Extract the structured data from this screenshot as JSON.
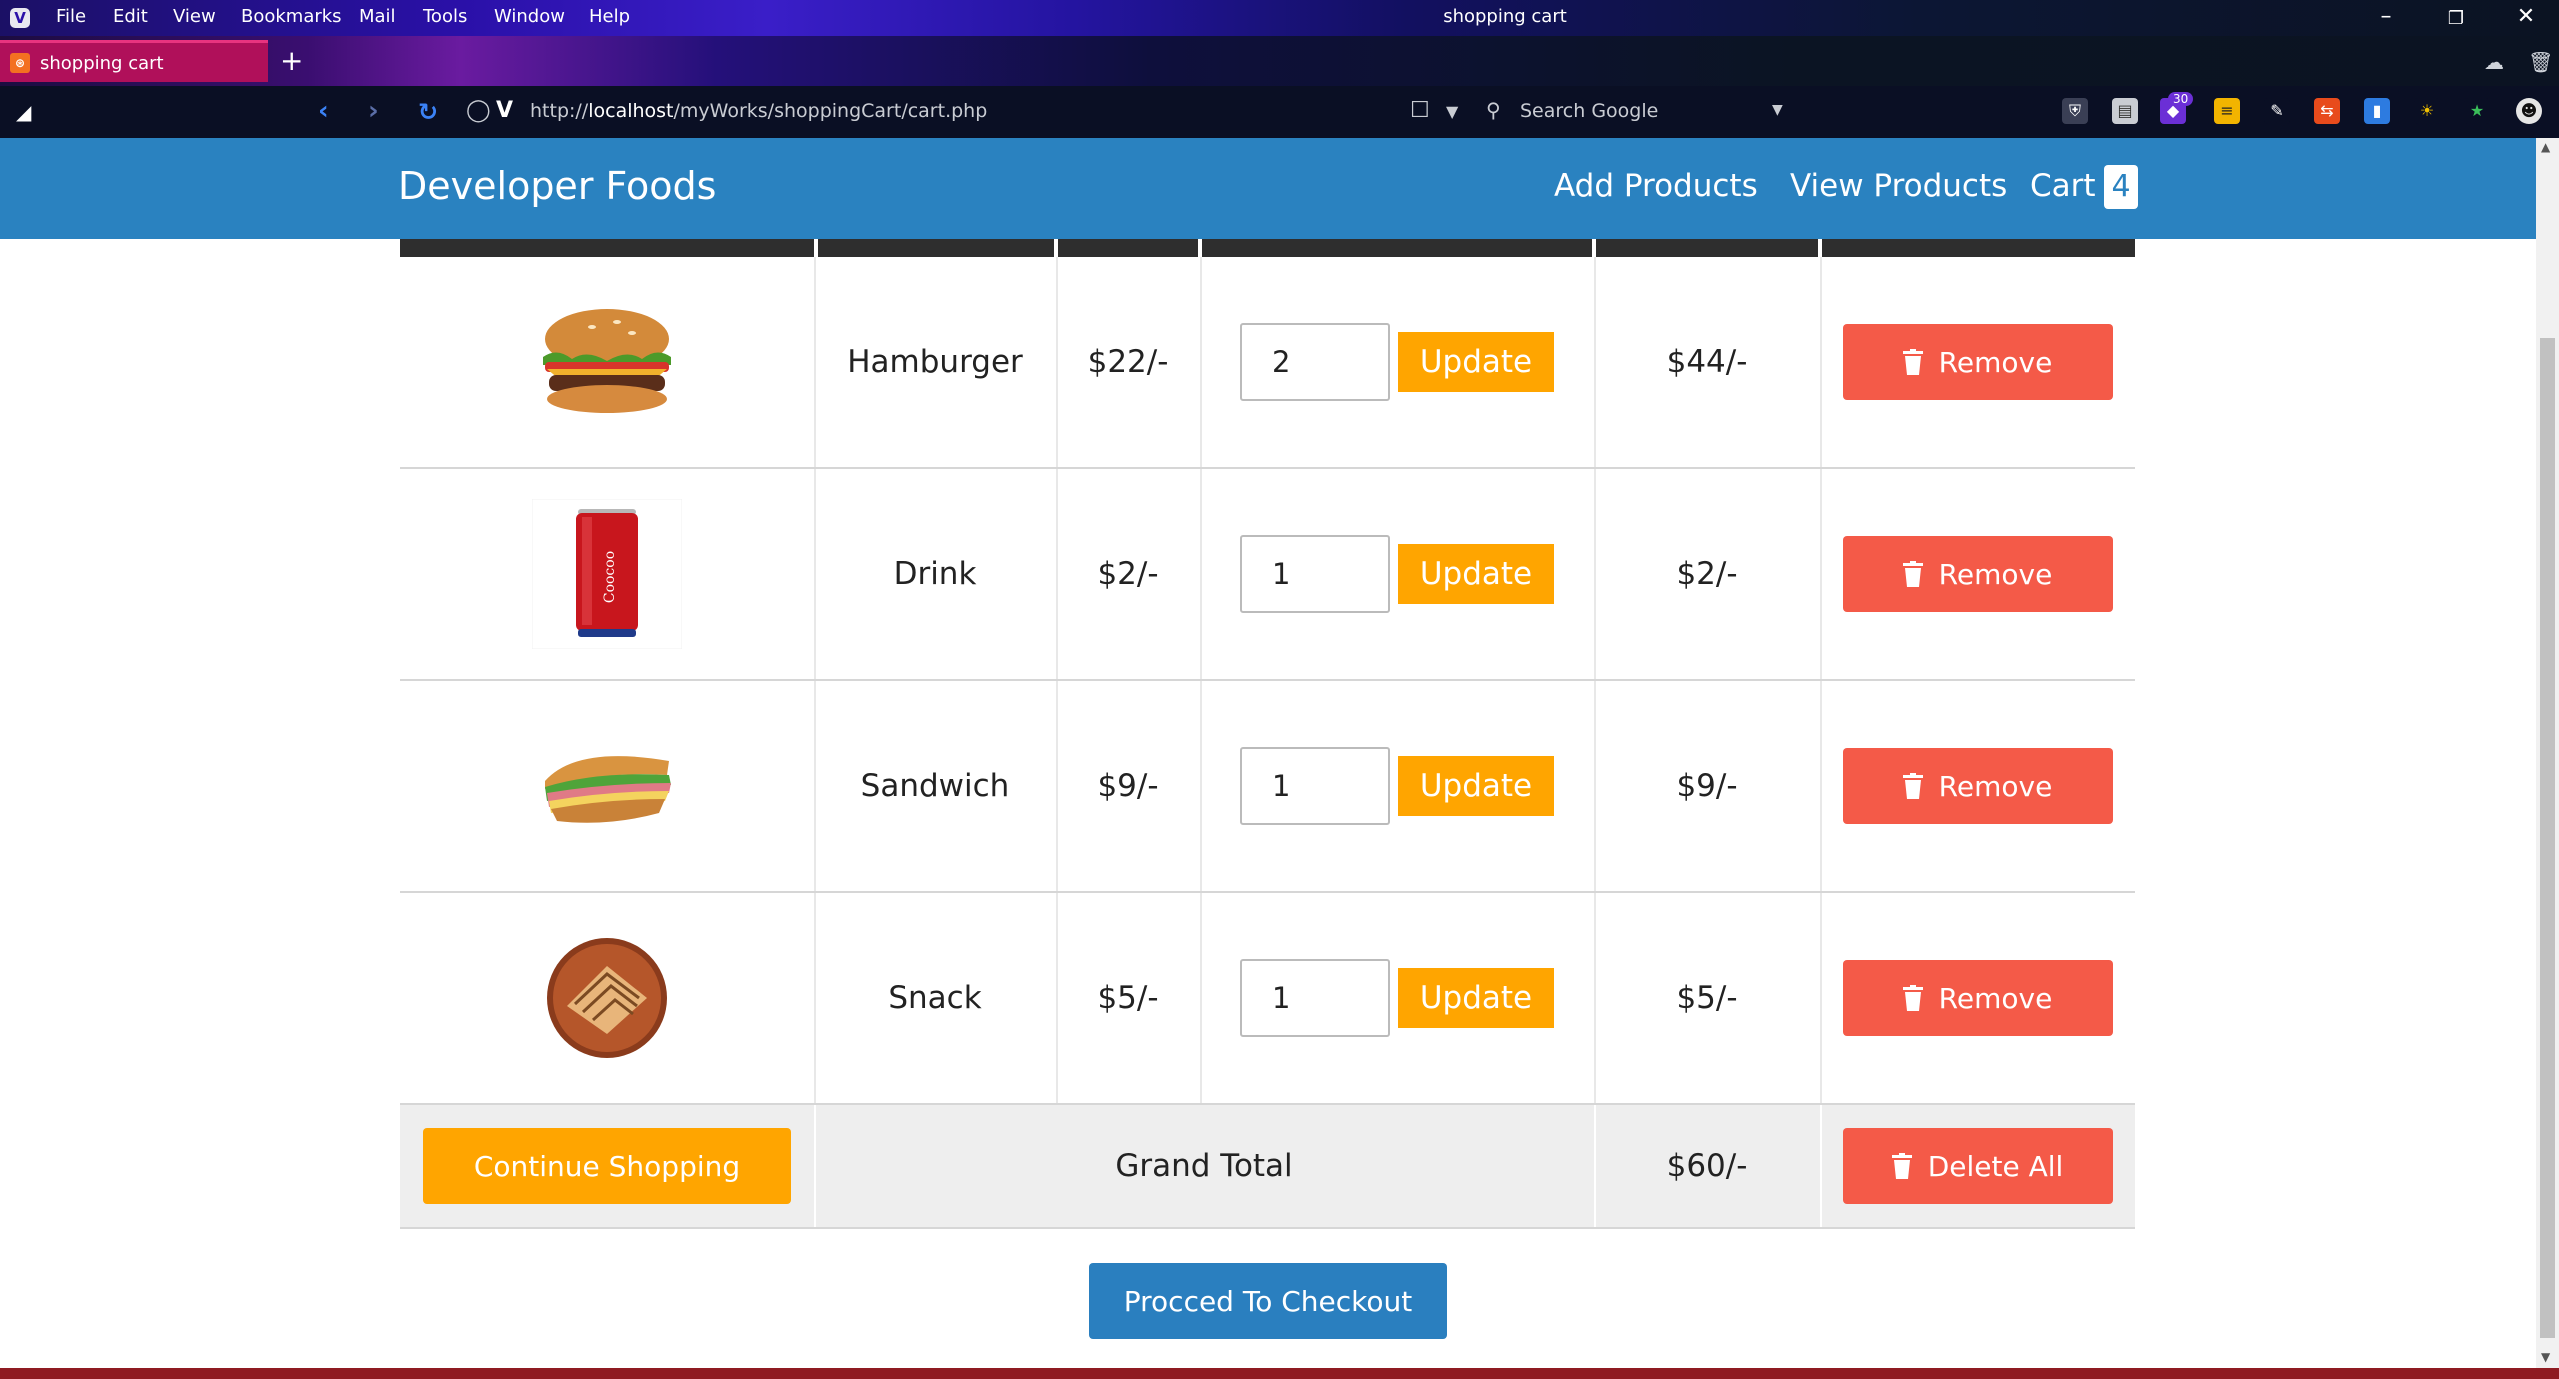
{
  "browser": {
    "menu": [
      "File",
      "Edit",
      "View",
      "Bookmarks",
      "Mail",
      "Tools",
      "Window",
      "Help"
    ],
    "window_title": "shopping cart",
    "tab_title": "shopping cart",
    "url_prefix": "http://",
    "url_host": "localhost",
    "url_path": "/myWorks/shoppingCart/cart.php",
    "search_placeholder": "Search Google",
    "extension_badge": "30"
  },
  "site": {
    "brand": "Developer Foods",
    "nav": {
      "add": "Add Products",
      "view": "View Products",
      "cart": "Cart",
      "cart_count": "4"
    }
  },
  "cart": {
    "items": [
      {
        "name": "Hamburger",
        "price": "$22/-",
        "quantity": "2",
        "total": "$44/-",
        "image": "hamburger-image"
      },
      {
        "name": "Drink",
        "price": "$2/-",
        "quantity": "1",
        "total": "$2/-",
        "image": "drink-can-image"
      },
      {
        "name": "Sandwich",
        "price": "$9/-",
        "quantity": "1",
        "total": "$9/-",
        "image": "sandwich-image"
      },
      {
        "name": "Snack",
        "price": "$5/-",
        "quantity": "1",
        "total": "$5/-",
        "image": "snack-image"
      }
    ],
    "update_label": "Update",
    "remove_label": "Remove",
    "continue_label": "Continue Shopping",
    "grand_total_label": "Grand Total",
    "grand_total": "$60/-",
    "delete_all_label": "Delete All",
    "checkout_label": "Procced To Checkout",
    "can_text": "Coocoo"
  },
  "colors": {
    "nav_bg": "#2a82c0",
    "update": "#ffa500",
    "remove": "#f45a48",
    "checkout": "#2a7fbf",
    "tab_active": "#b0105a"
  }
}
